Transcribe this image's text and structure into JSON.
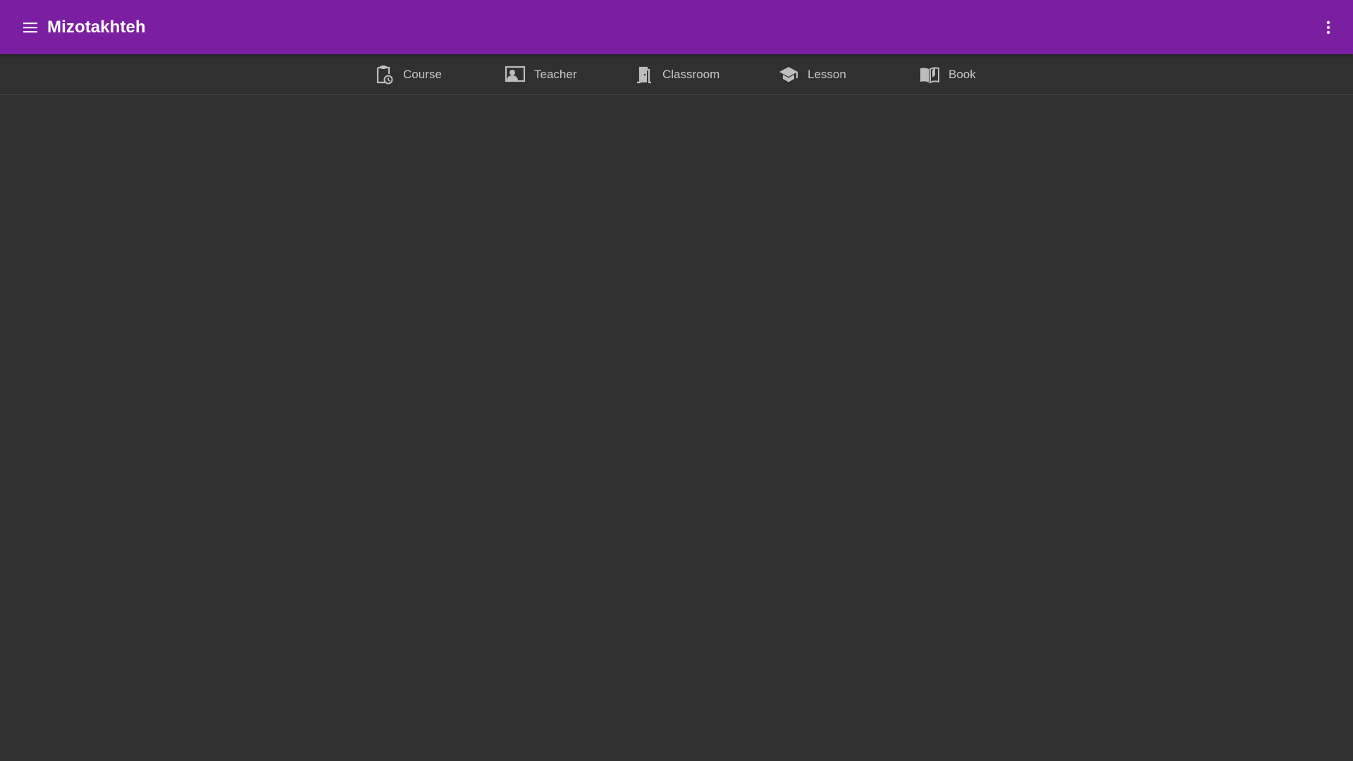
{
  "app": {
    "title": "Mizotakhteh",
    "accent_color": "#7b1fa2",
    "background_color": "#303030"
  },
  "appbar": {
    "menu_icon": "menu-icon",
    "more_icon": "more-vert-icon"
  },
  "tabs": [
    {
      "label": "Course",
      "icon": "clipboard-clock-icon"
    },
    {
      "label": "Teacher",
      "icon": "co-present-icon"
    },
    {
      "label": "Classroom",
      "icon": "meeting-room-icon"
    },
    {
      "label": "Lesson",
      "icon": "school-icon"
    },
    {
      "label": "Book",
      "icon": "menu-book-icon"
    }
  ]
}
